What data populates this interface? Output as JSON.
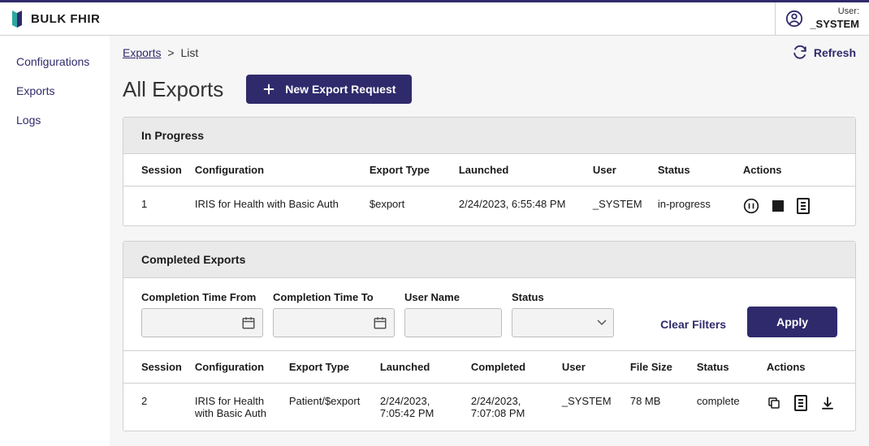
{
  "header": {
    "app_title": "BULK FHIR",
    "user_label": "User:",
    "user_name": "_SYSTEM"
  },
  "sidebar": {
    "items": [
      {
        "label": "Configurations"
      },
      {
        "label": "Exports"
      },
      {
        "label": "Logs"
      }
    ]
  },
  "breadcrumb": {
    "root": "Exports",
    "current": "List",
    "refresh_label": "Refresh"
  },
  "page": {
    "title": "All Exports",
    "new_button": "New Export Request"
  },
  "in_progress": {
    "title": "In Progress",
    "columns": {
      "session": "Session",
      "config": "Configuration",
      "export_type": "Export Type",
      "launched": "Launched",
      "user": "User",
      "status": "Status",
      "actions": "Actions"
    },
    "rows": [
      {
        "session": "1",
        "config": "IRIS for Health with Basic Auth",
        "export_type": "$export",
        "launched": "2/24/2023, 6:55:48 PM",
        "user": "_SYSTEM",
        "status": "in-progress"
      }
    ]
  },
  "completed": {
    "title": "Completed Exports",
    "filters": {
      "from_label": "Completion Time From",
      "to_label": "Completion Time To",
      "user_label": "User Name",
      "status_label": "Status",
      "clear_label": "Clear Filters",
      "apply_label": "Apply"
    },
    "columns": {
      "session": "Session",
      "config": "Configuration",
      "export_type": "Export Type",
      "launched": "Launched",
      "completed": "Completed",
      "user": "User",
      "file_size": "File Size",
      "status": "Status",
      "actions": "Actions"
    },
    "rows": [
      {
        "session": "2",
        "config": "IRIS for Health with Basic Auth",
        "export_type": "Patient/$export",
        "launched": "2/24/2023, 7:05:42 PM",
        "completed": "2/24/2023, 7:07:08 PM",
        "user": "_SYSTEM",
        "file_size": "78 MB",
        "status": "complete"
      }
    ]
  }
}
